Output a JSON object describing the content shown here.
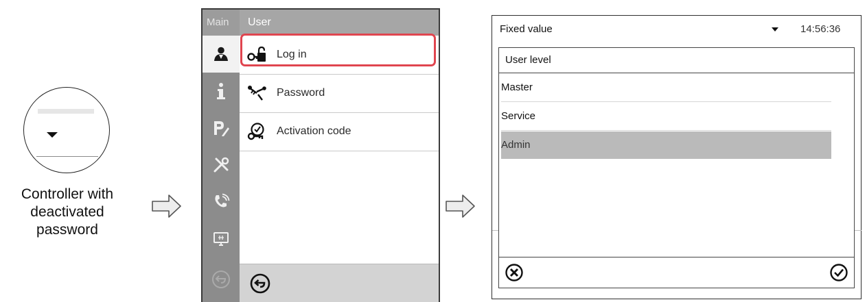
{
  "left": {
    "caption_lines": [
      "Controller with",
      "deactivated",
      "password"
    ]
  },
  "menu": {
    "sidebar_label": "Main",
    "header": "User",
    "items": [
      {
        "label": "Log in",
        "icon": "login-key-icon",
        "highlighted": true
      },
      {
        "label": "Password",
        "icon": "password-keys-icon",
        "highlighted": false
      },
      {
        "label": "Activation code",
        "icon": "activation-code-icon",
        "highlighted": false
      }
    ],
    "sidebar_icons": [
      "user-icon",
      "info-icon",
      "program-edit-icon",
      "tools-icon",
      "phone-icon",
      "display-icon",
      "back-icon-disabled"
    ],
    "highlight_color": "#e0454f"
  },
  "dialog": {
    "title": "Fixed value",
    "time": "14:56:36",
    "heading": "User level",
    "options": [
      {
        "label": "Master",
        "selected": false
      },
      {
        "label": "Service",
        "selected": false
      },
      {
        "label": "Admin",
        "selected": true
      }
    ],
    "cancel_icon": "cancel-x-icon",
    "confirm_icon": "checkmark-icon"
  }
}
